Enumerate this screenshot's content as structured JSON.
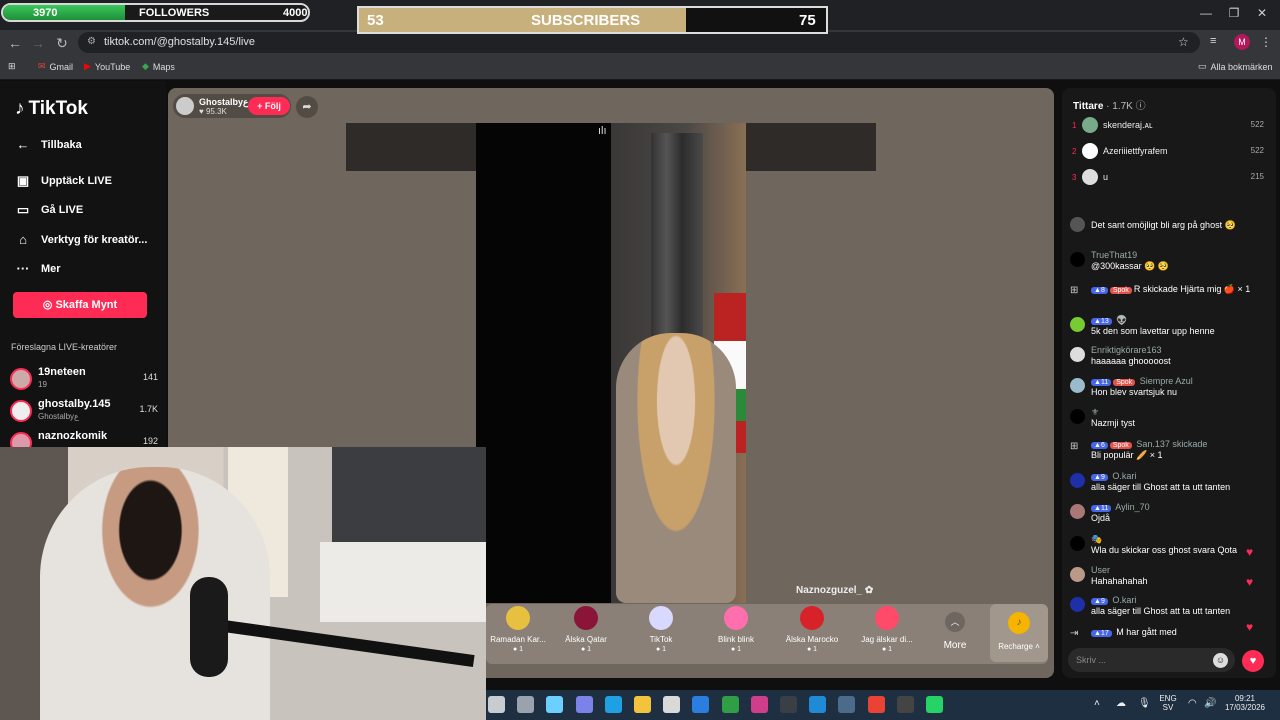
{
  "overlay": {
    "followers": {
      "current": "3970",
      "label": "FOLLOWERS",
      "goal": "4000",
      "progress": 0.4
    },
    "subscribers": {
      "current": "53",
      "label": "SUBSCRIBERS",
      "goal": "75",
      "progress": 0.7
    }
  },
  "browser": {
    "url": "tiktok.com/@ghostalby.145/live",
    "bookmarks": [
      "Gmail",
      "YouTube",
      "Maps"
    ],
    "all_bookmarks": "Alla bokmärken",
    "profile_initial": "M"
  },
  "sidebar": {
    "logo": "TikTok",
    "back": "Tillbaka",
    "items": [
      "Upptäck LIVE",
      "Gå LIVE",
      "Verktyg för kreatör...",
      "Mer"
    ],
    "coins_button": "Skaffa Mynt",
    "suggested_label": "Föreslagna LIVE-kreatörer",
    "creators": [
      {
        "name": "19neteen",
        "sub": "19",
        "count": "141"
      },
      {
        "name": "ghostalby.145",
        "sub": "Ghostalbyع",
        "count": "1.7K"
      },
      {
        "name": "naznozkomik",
        "sub": "",
        "count": "192"
      }
    ]
  },
  "stream": {
    "host_name": "Ghostalbyع",
    "host_likes": "95.3K",
    "follow_label": "+ Följ",
    "guest_name": "Naznozguzel_"
  },
  "gifts": [
    {
      "name": "Ramadan Kar...",
      "price": "1",
      "color": "#e8c040"
    },
    {
      "name": "Älska Qatar",
      "price": "1",
      "color": "#8a1538"
    },
    {
      "name": "TikTok",
      "price": "1",
      "color": "#d9d9ff"
    },
    {
      "name": "Blink blink",
      "price": "1",
      "color": "#ff6fae"
    },
    {
      "name": "Älska Marocko",
      "price": "1",
      "color": "#d8222a"
    },
    {
      "name": "Jag älskar di...",
      "price": "1",
      "color": "#ff4a6a"
    }
  ],
  "more_label": "More",
  "recharge_label": "Recharge",
  "panel": {
    "viewers_label": "Tittare",
    "viewers_count": "1.7K",
    "top": [
      {
        "rank": "1",
        "name": "skenderaj.ᴀʟ",
        "score": "522"
      },
      {
        "rank": "2",
        "name": "Azeriiiettfyrafem",
        "score": "522"
      },
      {
        "rank": "3",
        "name": "u",
        "score": "215"
      }
    ],
    "chat": [
      {
        "user": "",
        "text": "Det sant omöjligt bli arg på ghost 🥺"
      },
      {
        "user": "TrueThat19",
        "text": "@300kassar 🥺 🥺"
      },
      {
        "user": "",
        "text": "R skickade Hjärta mig 🍎 × 1"
      },
      {
        "user": "",
        "text": "5k den som lavettar upp henne"
      },
      {
        "user": "Enriktigkörare163",
        "text": "haaaaaa ghooooost"
      },
      {
        "user": "Siempre Azul",
        "text": "Hon blev svartsjuk nu"
      },
      {
        "user": "",
        "text": "Nazmji tyst"
      },
      {
        "user": "San.137 skickade",
        "text": "Bli populär 🥖 × 1"
      },
      {
        "user": "O.kari",
        "text": "alla säger till Ghost att ta utt tanten"
      },
      {
        "user": "Aylin_70",
        "text": "Ojdå"
      },
      {
        "user": "",
        "text": "Wla du skickar oss ghost svara Qota"
      },
      {
        "user": "User",
        "text": "Hahahahahah"
      },
      {
        "user": "O.kari",
        "text": "alla säger till Ghost att ta utt tanten"
      },
      {
        "user": "",
        "text": "M  har gått med"
      }
    ],
    "input_placeholder": "Skriv ..."
  },
  "badges": {
    "b8": "8",
    "b13": "13",
    "b11": "11",
    "b6": "6",
    "b9": "9",
    "b17": "17",
    "spok": "Spok"
  },
  "taskbar": {
    "lang": "ENG",
    "region": "SV",
    "time": "09:21",
    "date": "17/03/2026",
    "notif": "36"
  }
}
